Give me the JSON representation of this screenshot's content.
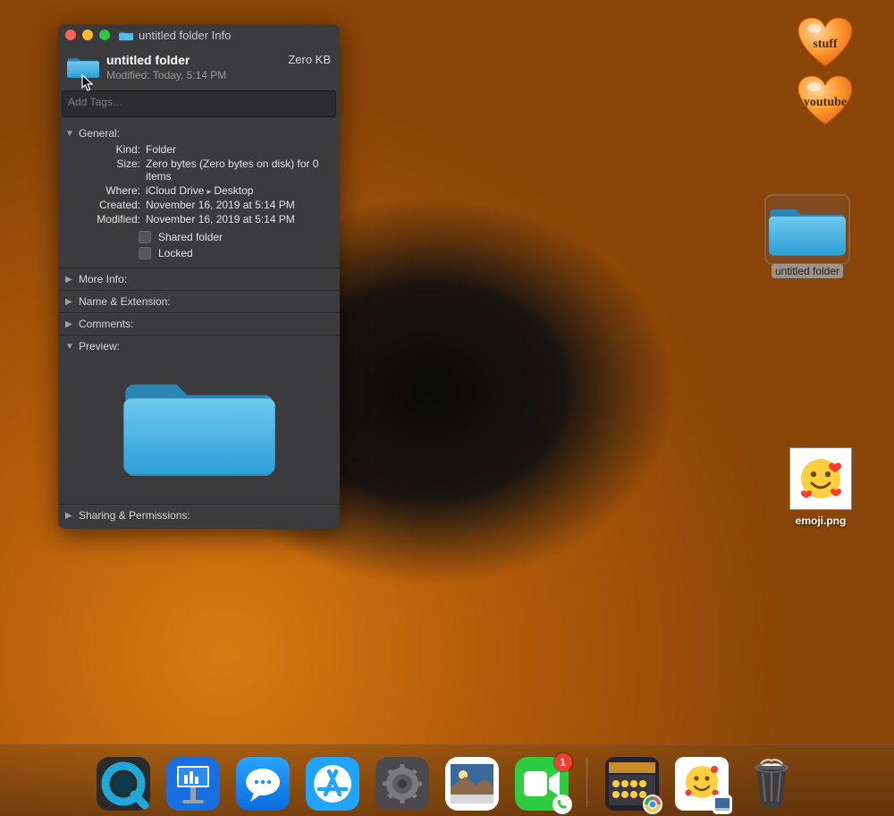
{
  "info": {
    "window_title": "untitled folder Info",
    "name": "untitled folder",
    "modified_line": "Modified: Today, 5:14 PM",
    "size_short": "Zero KB",
    "tags_placeholder": "Add Tags…",
    "general": {
      "heading": "General:",
      "kind_label": "Kind:",
      "kind": "Folder",
      "size_label": "Size:",
      "size": "Zero bytes (Zero bytes on disk) for 0 items",
      "where_label": "Where:",
      "where_a": "iCloud Drive",
      "where_b": "Desktop",
      "created_label": "Created:",
      "created": "November 16, 2019 at 5:14 PM",
      "modified_label": "Modified:",
      "modified": "November 16, 2019 at 5:14 PM",
      "shared_label": "Shared folder",
      "locked_label": "Locked"
    },
    "sections": {
      "more_info": "More Info:",
      "name_ext": "Name & Extension:",
      "comments": "Comments:",
      "preview": "Preview:",
      "sharing": "Sharing & Permissions:"
    }
  },
  "desktop": {
    "heart1": "stuff",
    "heart2": "youtube",
    "folder_label": "untitled folder",
    "emoji_label": "emoji.png"
  },
  "dock": {
    "messages_badge": "1"
  }
}
